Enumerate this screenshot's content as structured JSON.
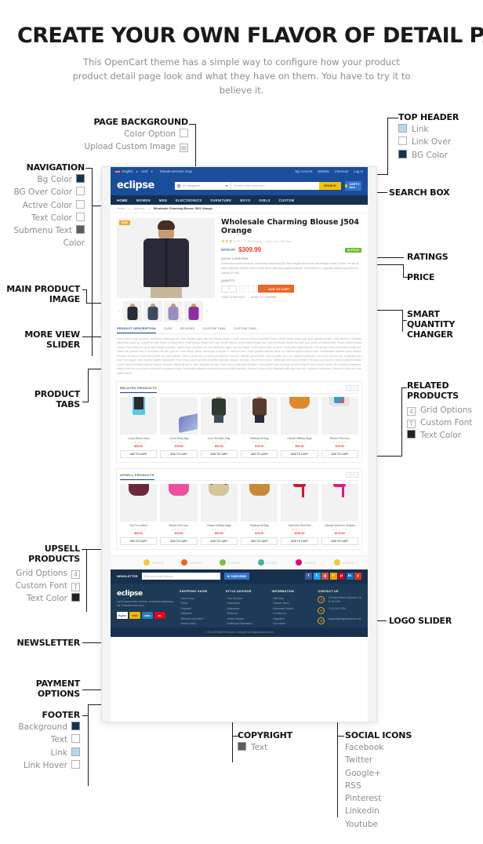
{
  "hero": {
    "title": "CREATE YOUR OWN FLAVOR OF DETAIL PAGE",
    "subtitle": "This OpenCart theme has a simple way to configure how your product product detail page look and what they have on them. You have to try it to believe it."
  },
  "annotations": {
    "page_background": {
      "title": "PAGE BACKGROUND",
      "items": [
        {
          "label": "Color Option",
          "swatch": "empty"
        },
        {
          "label": "Upload Custom Image",
          "swatch": "image"
        }
      ]
    },
    "top_header": {
      "title": "TOP HEADER",
      "items": [
        {
          "label": "Link",
          "swatch": "light-blue"
        },
        {
          "label": "Link Over",
          "swatch": "empty"
        },
        {
          "label": "BG Color",
          "swatch": "dark-blue"
        }
      ]
    },
    "search_box": {
      "title": "SEARCH BOX"
    },
    "navigation": {
      "title": "NAVIGATION",
      "items": [
        {
          "label": "Bg Color",
          "swatch": "dark-blue"
        },
        {
          "label": "BG Over Color",
          "swatch": "empty"
        },
        {
          "label": "Active  Color",
          "swatch": "empty"
        },
        {
          "label": "Text Color",
          "swatch": "empty"
        },
        {
          "label": "Submenu Text",
          "label2": "Color",
          "swatch": "gray"
        }
      ]
    },
    "main_product_image": {
      "title": "MAIN PRODUCT",
      "title2": "IMAGE"
    },
    "more_view_slider": {
      "title": "MORE VIEW",
      "title2": "SLIDER"
    },
    "product_tabs": {
      "title": "PRODUCT",
      "title2": "TABS"
    },
    "ratings": {
      "title": "RATINGS"
    },
    "price": {
      "title": "PRICE"
    },
    "smart_quantity": {
      "title": "SMART",
      "title2": "QUANTITY",
      "title3": "CHANGER"
    },
    "related_products": {
      "title": "RELATED",
      "title2": "PRODUCTS",
      "items": [
        {
          "label": "Grid Options",
          "swatch": "4"
        },
        {
          "label": "Custom Font",
          "swatch": "T"
        },
        {
          "label": "Text Color",
          "swatch": "black"
        }
      ]
    },
    "upsell_products": {
      "title": "UPSELL",
      "title2": "PRODUCTS",
      "items": [
        {
          "label": "Grid Options",
          "swatch": "4"
        },
        {
          "label": "Custom Font",
          "swatch": "T"
        },
        {
          "label": "Text Color",
          "swatch": "black"
        }
      ]
    },
    "logo_slider": {
      "title": "LOGO SLIDER"
    },
    "newsletter": {
      "title": "NEWSLETTER"
    },
    "payment_options": {
      "title": "PAYMENT",
      "title2": "OPTIONS"
    },
    "footer": {
      "title": "FOOTER",
      "items": [
        {
          "label": "Background",
          "swatch": "dark-blue"
        },
        {
          "label": "Text",
          "swatch": "empty"
        },
        {
          "label": "Link",
          "swatch": "light-blue"
        },
        {
          "label": "Link Hover",
          "swatch": "empty"
        }
      ]
    },
    "copyright": {
      "title": "COPYRIGHT",
      "items": [
        {
          "label": "Text",
          "swatch": "gray"
        }
      ]
    },
    "social_icons": {
      "title": "SOCIAL ICONS",
      "items": [
        "Facebook",
        "Twitter",
        "Google+",
        "RSS",
        "Pinterest",
        "Linkedin",
        "Youtube"
      ]
    }
  },
  "site": {
    "topbar": {
      "language": "English",
      "currency": "USD",
      "welcome": "Default welcome msg!",
      "links": [
        "My Account",
        "Wishlist",
        "Checkout",
        "Log In"
      ]
    },
    "header": {
      "brand": "eclipse",
      "search_category": "All Categories",
      "search_placeholder": "Search entire store here...",
      "search_button": "SEARCH",
      "cart_label": "CART 0 item"
    },
    "nav": [
      "HOME",
      "WOMEN",
      "MEN",
      "ELECTRONICS",
      "FURNITURE",
      "BOYS",
      "GIRLS",
      "CUSTOM"
    ],
    "breadcrumb": [
      "Home",
      "Women",
      "Wholesale Charming Blouse J504 Orange"
    ],
    "product": {
      "badge": "NEW",
      "title": "Wholesale Charming Blouse J504 Orange",
      "stars": "★★★",
      "stars_empty": "★★",
      "review_text": "1 Review(s)  |  Add Your Review",
      "old_price": "$345.00",
      "new_price": "$309.99",
      "stock_badge": "IN STOCK",
      "overview_label": "QUICK OVERVIEW",
      "overview": "Lorem ipsum dolor sit amet, consectetur adipiscing elit. Nam fringilla augue nec est tristique auctor. Donec non est at libero vulputate rutrum. Morbi ornare lectus quis justo gravida semper. Nulla tellus mi, vulputate adipiscing cursus eu, suscipit id nulla.",
      "quantity_label": "QUANTITY:",
      "quantity_value": "1",
      "add_to_cart": "ADD TO CART",
      "wishlist": "ADD TO WISHLIST",
      "compare": "ADD TO COMPARE"
    },
    "tabs": [
      "PRODUCT DESCRIPTION",
      "TAGS",
      "REVIEWS",
      "CUSTOM TAB1",
      "CUSTOM TAB2"
    ],
    "tab_text": "Lorem ipsum dolor sit amet, consectetur adipiscing elit. Nam fringilla augue nec est tristique auctor. Donec non est at libero vulputate rutrum. Morbi ornare lectus quis justo gravida semper. Nulla tellus mi, vulputate adipiscing cursus eu, suscipit id nulla. Donec a neque libero. Pellentesque aliquet sem eget laoreet ultrices, ipsum metus feugiat sem, quis fermentum turpis eros eget velit. Donec ac tempus ante. Fusce ultrices massa massa. Fusce aliquam, purus eget sagittis vulputate, sapien libero hendrerit est, sed commodo augue nisi non neque. Lorem ipsum dolor sit amet, consectetur adipiscing elit. Sed tempor, lorem et placerat vestibulum, metus nisi posuere nisl, in accumsan elit odio quis mi. Cras neque metus, consequat et blandit et, luctus a nunc. Etiam gravida vehicula tellus, in imperdiet ligula euismod eget. Pellentesque habitant morbi tristique senectus et netus et malesuada fames ac turpis egestas. Nam at porta erat, in rutrum at sollicitudin rhoncus, ultricies posuere erat. Duis convallis, arcu nec aliquam consequat, purus felis vehicula nisi, a dapibus enim lorem nec augue. Nunc facilisis sagittis ullamcorper. Proin lectus ipsum, gravida et mattis vulputate, tristique ut lectus. Sed et lorem nunc. Vestibulum ante ipsum primis in faucibus orci luctus et ultrices posuere cubilia Curae; Aenean eleifend laoreet congue. Vivamus adipiscing nisl ut dolor dignissim semper. Nulla luctus malesuada tincidunt. Class aptent taciti sociosqu ad litora torquent per conubia nostra, per inceptos himenaeos. Integer enim purus, posuere at ultricies eu, placerat a felis. Suspendisse aliquet urna pretium eros convallis interdum. Quisque in arcu id dui vulputate mollis eget non arcu. Aenean et nulla purus. Mauris ve tellus non nunc mattis lobortis.",
    "related": {
      "heading": "RELATED PRODUCTS",
      "products": [
        {
          "name": "Lucky Brand Janis",
          "price": "$65.00",
          "stars": 0,
          "button": "ADD TO CART",
          "art": "phone"
        },
        {
          "name": "Cross Body Bag",
          "price": "$75.00",
          "stars": 0,
          "button": "ADD TO CART",
          "art": "chair"
        },
        {
          "name": "Icon Shoulder Bag",
          "price": "$60.00",
          "stars": 0,
          "button": "ADD TO CART",
          "art": "man"
        },
        {
          "name": "Waterproof Bag",
          "price": "$75.00",
          "stars": 0,
          "button": "ADD TO CART",
          "art": "woman"
        },
        {
          "name": "Classic Military Bags",
          "price": "$60.00",
          "stars": 0,
          "button": "ADD TO CART",
          "art": "bag-orange"
        },
        {
          "name": "Bloom Print Icon",
          "price": "$75.00",
          "stars": 0,
          "button": "ADD TO CART",
          "art": "watch"
        }
      ]
    },
    "upsell": {
      "heading": "UPSELL PRODUCTS",
      "products": [
        {
          "name": "Girl Pu Leather",
          "price": "$60.00",
          "stars": 0,
          "button": "ADD TO CART",
          "art": "bag-maroon"
        },
        {
          "name": "Bloom Print Icon",
          "price": "$75.00",
          "stars": 0,
          "button": "ADD TO CART",
          "art": "bag-pink"
        },
        {
          "name": "Classic Military Bags",
          "price": "$60.00",
          "stars": 0,
          "button": "ADD TO CART",
          "art": "bag-beige"
        },
        {
          "name": "Waterproof Bag",
          "price": "$75.00",
          "stars": 0,
          "button": "ADD TO CART",
          "art": "bag-tan"
        },
        {
          "name": "Synthetic Red Heel",
          "price": "$150.00",
          "stars": 2,
          "button": "ADD TO CART",
          "art": "heel-red"
        },
        {
          "name": "Catwalk Women's Slippers",
          "price": "$175.00",
          "stars": 0,
          "button": "ADD TO CART",
          "art": "heel-pink"
        }
      ]
    },
    "logo_slider": {
      "label": "LOGO",
      "brands": [
        {
          "color": "#f5c842"
        },
        {
          "color": "#f26322"
        },
        {
          "color": "#7ac143"
        },
        {
          "color": "#3fb59b"
        },
        {
          "color": "#e6007e"
        },
        {
          "color": "#f5c842"
        }
      ]
    },
    "newsletter": {
      "label": "NEWSLETTER",
      "placeholder": "Enter your email address",
      "button": "SUBSCRIBE"
    },
    "socials": [
      {
        "name": "facebook",
        "glyph": "f",
        "color": "#3b5998"
      },
      {
        "name": "twitter",
        "glyph": "t",
        "color": "#1da1f2"
      },
      {
        "name": "google-plus",
        "glyph": "g",
        "color": "#dd4b39"
      },
      {
        "name": "rss",
        "glyph": "r",
        "color": "#f59f00"
      },
      {
        "name": "pinterest",
        "glyph": "p",
        "color": "#bd081c"
      },
      {
        "name": "linkedin",
        "glyph": "in",
        "color": "#0077b5"
      },
      {
        "name": "youtube",
        "glyph": "y",
        "color": "#e52d27"
      }
    ],
    "footer": {
      "brand": "eclipse",
      "description": "Lorem ipsum dolor sit amet, consectetur adipiscing elit. Phasellus diam arcu.",
      "payments": [
        {
          "name": "PayPal",
          "label": "PayPal",
          "color": "#ffffff",
          "text": "#003087"
        },
        {
          "name": "Visa",
          "label": "VISA",
          "color": "#f7b600",
          "text": "#1a1f71"
        },
        {
          "name": "Amex",
          "label": "AMEX",
          "color": "#2e77bb",
          "text": "#ffffff"
        },
        {
          "name": "Mastercard",
          "label": "MC",
          "color": "#eb001b",
          "text": "#ffffff"
        }
      ],
      "columns": [
        {
          "heading": "SHOPPING GUIDE",
          "links": [
            "How to buy",
            "FAQs",
            "Payment",
            "Shipment",
            "Where is my order?",
            "Return policy"
          ]
        },
        {
          "heading": "STYLE ADVISOR",
          "links": [
            "Your Account",
            "Information",
            "Addresses",
            "Discount",
            "Orders History",
            "Additional Information"
          ]
        },
        {
          "heading": "INFORMATION",
          "links": [
            "Site Map",
            "Search Terms",
            "Advanced Search",
            "Contact Us",
            "Suppliers",
            "Our stores"
          ]
        }
      ],
      "contact": {
        "heading": "CONTACT US",
        "address": "123 Main Street, Anytown, CA 12 45 USA",
        "phone": "+1 (0) 123 1234",
        "email": "support@magicommerce.com"
      },
      "copyright": "© 2014  All Rights Reserved. Designed by magicommerce.com"
    }
  }
}
